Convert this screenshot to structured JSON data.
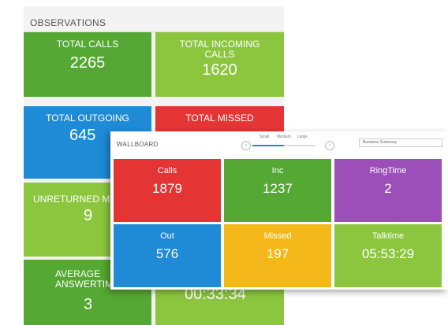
{
  "observations": {
    "title": "OBSERVATIONS",
    "tiles": [
      {
        "label": "TOTAL CALLS",
        "value": "2265",
        "color": "#55a833"
      },
      {
        "label": "TOTAL INCOMING CALLS",
        "value": "1620",
        "color": "#8cc63f"
      },
      {
        "label": "TOTAL OUTGOING",
        "value": "645",
        "color": "#1f8ad6"
      },
      {
        "label": "TOTAL MISSED",
        "value": "",
        "color": "#e53434"
      },
      {
        "label": "UNRETURNED M",
        "value": "9",
        "color": "#8cc63f"
      },
      {
        "label": "",
        "value": "",
        "color": "#8cc63f"
      },
      {
        "label": "AVERAGE ANSWERTIM",
        "value": "3",
        "color": "#55a833"
      },
      {
        "label": "",
        "value": "00:33:34",
        "color": "#8cc63f"
      }
    ]
  },
  "wallboard": {
    "title": "WALLBOARD",
    "size_labels": [
      "Small",
      "Medium",
      "Large"
    ],
    "size_level": 0.5,
    "prev_arrow": "‹",
    "next_arrow": "›",
    "search_value": "Business Summary",
    "tiles": [
      {
        "label": "Calls",
        "value": "1879",
        "color": "#e53434"
      },
      {
        "label": "Inc",
        "value": "1237",
        "color": "#55a833"
      },
      {
        "label": "RingTime",
        "value": "2",
        "color": "#9c4fb8"
      },
      {
        "label": "Out",
        "value": "576",
        "color": "#1f8ad6"
      },
      {
        "label": "Missed",
        "value": "197",
        "color": "#f4b81b"
      },
      {
        "label": "Talktime",
        "value": "05:53:29",
        "color": "#8cc63f"
      }
    ]
  }
}
